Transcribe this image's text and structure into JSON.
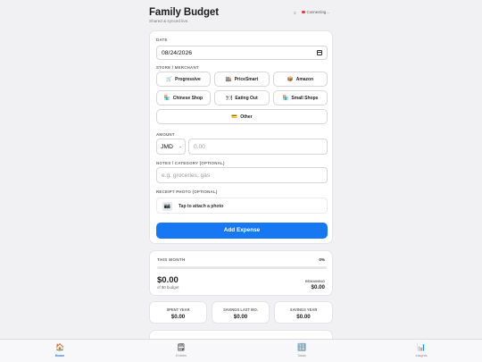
{
  "header": {
    "title": "Family Budget",
    "subtitle": "Shared & synced live.",
    "counter": "3",
    "status": "Connecting…"
  },
  "form": {
    "date_label": "DATE",
    "date_value": "08/24/2026",
    "store_label": "STORE / MERCHANT",
    "stores": [
      {
        "label": "Progressive",
        "icon": "cart-icon",
        "glyph": "🛒"
      },
      {
        "label": "PriceSmart",
        "icon": "store-icon",
        "glyph": "🏬"
      },
      {
        "label": "Amazon",
        "icon": "package-icon",
        "glyph": "📦"
      },
      {
        "label": "Chinese Shop",
        "icon": "shop-icon",
        "glyph": "🏪"
      },
      {
        "label": "Eating Out",
        "icon": "cutlery-icon",
        "glyph": "🍽"
      },
      {
        "label": "Small Shops",
        "icon": "small-shop-icon",
        "glyph": "🏪"
      },
      {
        "label": "Other",
        "icon": "card-icon",
        "glyph": "💳"
      }
    ],
    "amount_label": "AMOUNT",
    "currency": "JMD",
    "amount_placeholder": "0.00",
    "notes_label": "NOTES / CATEGORY (OPTIONAL)",
    "notes_placeholder": "e.g. groceries, gas",
    "photo_label": "RECEIPT PHOTO (OPTIONAL)",
    "photo_text": "Tap to attach a photo",
    "add_button": "Add Expense"
  },
  "month": {
    "label": "THIS MONTH",
    "percent": "0%",
    "progress": 0,
    "spent": "$0.00",
    "budget": "of $0 budget",
    "remaining_label": "REMAINING",
    "remaining": "$0.00"
  },
  "stats": [
    {
      "label": "SPENT YEAR",
      "value": "$0.00"
    },
    {
      "label": "SAVINGS LAST MO.",
      "value": "$0.00"
    },
    {
      "label": "SAVINGS YEAR",
      "value": "$0.00"
    }
  ],
  "tabs": [
    {
      "label": "Home",
      "icon": "home-icon",
      "glyph": "🏠",
      "active": true
    },
    {
      "label": "Entries",
      "icon": "entries-icon",
      "glyph": "🗒",
      "active": false
    },
    {
      "label": "Totals",
      "icon": "totals-icon",
      "glyph": "🔢",
      "active": false
    },
    {
      "label": "Insights",
      "icon": "insights-icon",
      "glyph": "📊",
      "active": false
    }
  ],
  "colors": {
    "accent": "#1877f2",
    "status": "#e53935"
  }
}
